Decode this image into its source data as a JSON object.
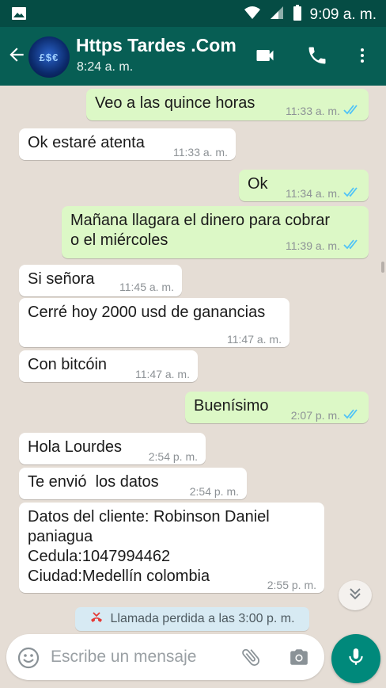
{
  "status_bar": {
    "time": "9:09 a. m."
  },
  "header": {
    "contact_name": "Https Tardes .Com",
    "subtitle": "8:24 a. m."
  },
  "messages": [
    {
      "dir": "out",
      "text": "Veo a las quince horas",
      "time": "11:33 a. m.",
      "read": true
    },
    {
      "dir": "in",
      "text": "Ok estaré atenta",
      "time": "11:33 a. m."
    },
    {
      "dir": "out",
      "text": "Ok",
      "time": "11:34 a. m.",
      "read": true
    },
    {
      "dir": "out",
      "lines": [
        "Mañana llagara el dinero para cobrar",
        "o el miércoles"
      ],
      "time": "11:39 a. m.",
      "read": true
    },
    {
      "dir": "in",
      "text": "Si señora",
      "time": "11:45 a. m."
    },
    {
      "dir": "in",
      "text": "Cerré hoy 2000 usd de ganancias",
      "time": "11:47 a. m."
    },
    {
      "dir": "in",
      "text": "Con bitcóin",
      "time": "11:47 a. m."
    },
    {
      "dir": "out",
      "text": "Buenísimo",
      "time": "2:07 p. m.",
      "read": true
    },
    {
      "dir": "in",
      "text": "Hola Lourdes",
      "time": "2:54 p. m."
    },
    {
      "dir": "in",
      "text": "Te envió  los datos",
      "time": "2:54 p. m."
    },
    {
      "dir": "in",
      "lines": [
        "Datos del cliente: Robinson Daniel",
        "paniagua",
        "Cedula:1047994462",
        "Ciudad:Medellín colombia"
      ],
      "time": "2:55 p. m."
    }
  ],
  "missed_call": {
    "text": "Llamada perdida a las 3:00 p. m."
  },
  "composer": {
    "placeholder": "Escribe un mensaje"
  },
  "colors": {
    "header": "#075e54",
    "statusbar": "#054c44",
    "outgoing": "#dcf8c6",
    "incoming": "#ffffff",
    "read_ticks": "#4fc3f7",
    "mic": "#00897b"
  },
  "icons": [
    "image-icon",
    "wifi-icon",
    "signal-icon",
    "battery-icon",
    "back-arrow-icon",
    "video-call-icon",
    "phone-icon",
    "more-vert-icon",
    "double-check-icon",
    "chevron-down-icon",
    "missed-call-icon",
    "emoji-icon",
    "attach-icon",
    "camera-icon",
    "mic-icon"
  ]
}
